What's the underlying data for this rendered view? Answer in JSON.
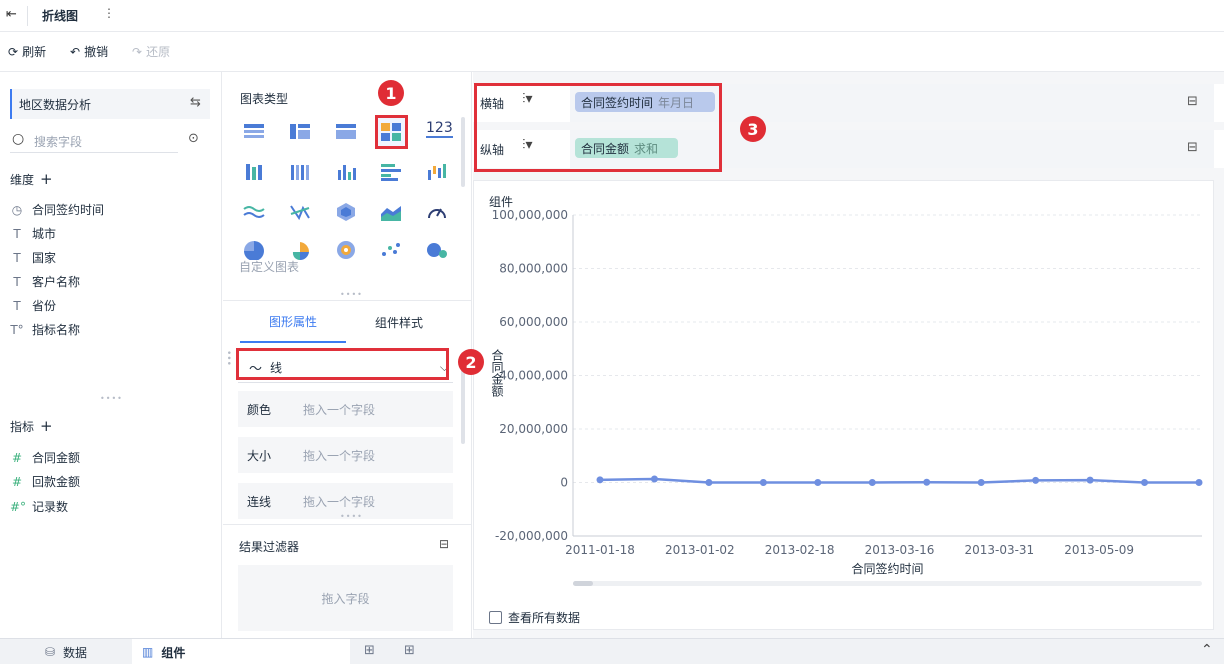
{
  "topbar": {
    "title": "折线图"
  },
  "toolbar": {
    "refresh": "刷新",
    "undo": "撤销",
    "redo": "还原"
  },
  "left": {
    "dataset": "地区数据分析",
    "search_placeholder": "搜索字段",
    "dimensions_label": "维度",
    "dimensions": [
      "合同签约时间",
      "城市",
      "国家",
      "客户名称",
      "省份",
      "指标名称"
    ],
    "measures_label": "指标",
    "measures": [
      "合同金额",
      "回款金额",
      "记录数"
    ]
  },
  "mid": {
    "chart_types_label": "图表类型",
    "number_icon": "123",
    "custom_chart": "自定义图表",
    "tabs": [
      "图形属性",
      "组件样式"
    ],
    "mark_type": "线",
    "props": [
      {
        "label": "颜色",
        "hint": "拖入一个字段"
      },
      {
        "label": "大小",
        "hint": "拖入一个字段"
      },
      {
        "label": "连线",
        "hint": "拖入一个字段"
      }
    ],
    "result_filter_label": "结果过滤器",
    "result_filter_hint": "拖入字段"
  },
  "axes": {
    "x_label": "横轴",
    "x_field": "合同签约时间",
    "x_field_sub": "年月日",
    "y_label": "纵轴",
    "y_field": "合同金额",
    "y_field_sub": "求和"
  },
  "widget": {
    "title": "组件",
    "show_all": "查看所有数据"
  },
  "badges": [
    "1",
    "2",
    "3"
  ],
  "chart_data": {
    "type": "line",
    "xlabel": "合同签约时间",
    "ylabel": "合同金额",
    "ylim": [
      -20000000,
      100000000
    ],
    "yticks": [
      "100,000,000",
      "80,000,000",
      "60,000,000",
      "40,000,000",
      "20,000,000",
      "0",
      "-20,000,000"
    ],
    "x_tick_labels": [
      "2011-01-18",
      "2013-01-02",
      "2013-02-18",
      "2013-03-16",
      "2013-03-31",
      "2013-05-09"
    ],
    "series": [
      {
        "values": [
          1000000,
          1300000,
          0,
          0,
          0,
          0,
          100000,
          0,
          800000,
          900000,
          0,
          0
        ]
      }
    ],
    "color": "#6f8fe0"
  },
  "bottombar": {
    "tab_data": "数据",
    "tab_widget": "组件"
  }
}
